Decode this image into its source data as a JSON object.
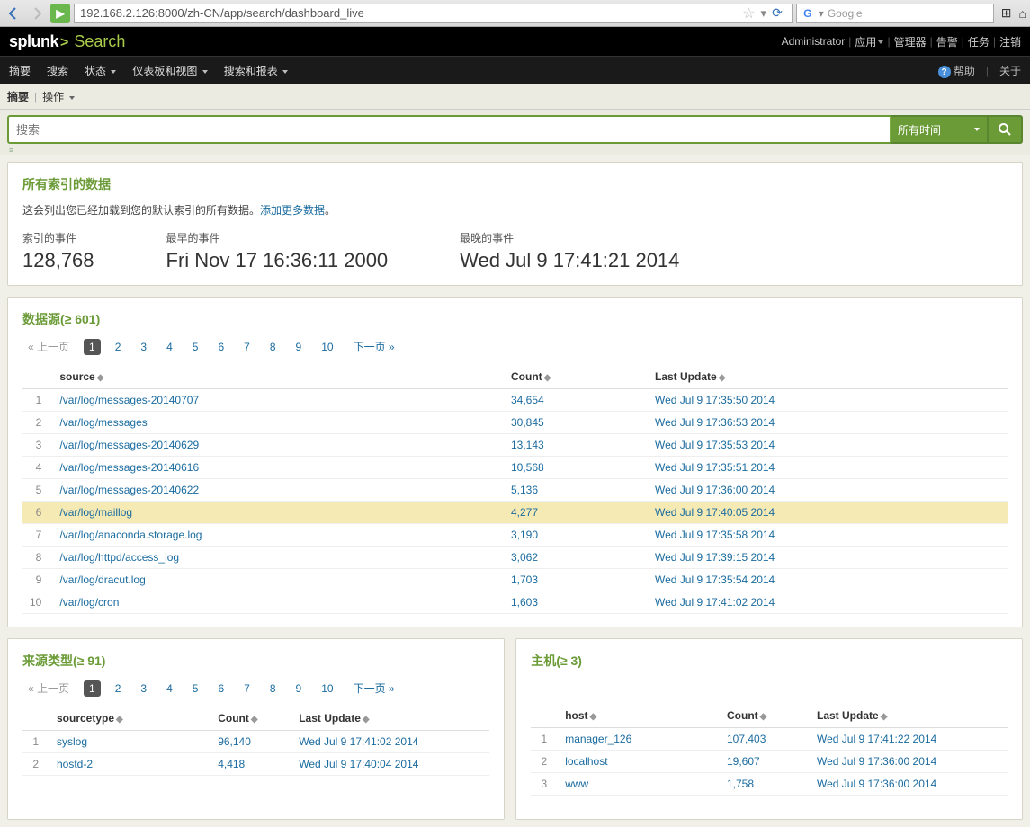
{
  "browser": {
    "url": "192.168.2.126:8000/zh-CN/app/search/dashboard_live",
    "search_placeholder": "Google"
  },
  "header": {
    "logo_primary": "splunk",
    "logo_secondary": "Search",
    "user": "Administrator",
    "top_links": {
      "app": "应用",
      "manager": "管理器",
      "alerts": "告警",
      "jobs": "任务",
      "logout": "注销"
    }
  },
  "nav": {
    "items": [
      "摘要",
      "搜索",
      "状态",
      "仪表板和视图",
      "搜索和报表"
    ],
    "help": "帮助",
    "about": "关于"
  },
  "subbar": {
    "summary": "摘要",
    "actions": "操作"
  },
  "search": {
    "placeholder": "搜索",
    "time": "所有时间"
  },
  "index_panel": {
    "title": "所有索引的数据",
    "desc": "这会列出您已经加载到您的默认索引的所有数据。",
    "add_more": "添加更多数据",
    "period": "。",
    "stats": [
      {
        "label": "索引的事件",
        "value": "128,768"
      },
      {
        "label": "最早的事件",
        "value": "Fri Nov 17 16:36:11 2000"
      },
      {
        "label": "最晚的事件",
        "value": "Wed Jul 9 17:41:21 2014"
      }
    ]
  },
  "sources_panel": {
    "title": "数据源(≥ 601)",
    "pagination": {
      "prev": "« 上一页",
      "pages": [
        "1",
        "2",
        "3",
        "4",
        "5",
        "6",
        "7",
        "8",
        "9",
        "10"
      ],
      "next": "下一页 »"
    },
    "columns": {
      "source": "source",
      "count": "Count",
      "last": "Last Update"
    },
    "rows": [
      {
        "n": "1",
        "source": "/var/log/messages-20140707",
        "count": "34,654",
        "last": "Wed Jul 9 17:35:50 2014"
      },
      {
        "n": "2",
        "source": "/var/log/messages",
        "count": "30,845",
        "last": "Wed Jul 9 17:36:53 2014"
      },
      {
        "n": "3",
        "source": "/var/log/messages-20140629",
        "count": "13,143",
        "last": "Wed Jul 9 17:35:53 2014"
      },
      {
        "n": "4",
        "source": "/var/log/messages-20140616",
        "count": "10,568",
        "last": "Wed Jul 9 17:35:51 2014"
      },
      {
        "n": "5",
        "source": "/var/log/messages-20140622",
        "count": "5,136",
        "last": "Wed Jul 9 17:36:00 2014"
      },
      {
        "n": "6",
        "source": "/var/log/maillog",
        "count": "4,277",
        "last": "Wed Jul 9 17:40:05 2014",
        "hl": true
      },
      {
        "n": "7",
        "source": "/var/log/anaconda.storage.log",
        "count": "3,190",
        "last": "Wed Jul 9 17:35:58 2014"
      },
      {
        "n": "8",
        "source": "/var/log/httpd/access_log",
        "count": "3,062",
        "last": "Wed Jul 9 17:39:15 2014"
      },
      {
        "n": "9",
        "source": "/var/log/dracut.log",
        "count": "1,703",
        "last": "Wed Jul 9 17:35:54 2014"
      },
      {
        "n": "10",
        "source": "/var/log/cron",
        "count": "1,603",
        "last": "Wed Jul 9 17:41:02 2014"
      }
    ]
  },
  "sourcetype_panel": {
    "title": "来源类型(≥ 91)",
    "pagination": {
      "prev": "« 上一页",
      "pages": [
        "1",
        "2",
        "3",
        "4",
        "5",
        "6",
        "7",
        "8",
        "9",
        "10"
      ],
      "next": "下一页 »"
    },
    "columns": {
      "source": "sourcetype",
      "count": "Count",
      "last": "Last Update"
    },
    "rows": [
      {
        "n": "1",
        "source": "syslog",
        "count": "96,140",
        "last": "Wed Jul 9 17:41:02 2014"
      },
      {
        "n": "2",
        "source": "hostd-2",
        "count": "4,418",
        "last": "Wed Jul 9 17:40:04 2014"
      }
    ]
  },
  "host_panel": {
    "title": "主机(≥ 3)",
    "columns": {
      "host": "host",
      "count": "Count",
      "last": "Last Update"
    },
    "rows": [
      {
        "n": "1",
        "host": "manager_126",
        "count": "107,403",
        "last": "Wed Jul 9 17:41:22 2014"
      },
      {
        "n": "2",
        "host": "localhost",
        "count": "19,607",
        "last": "Wed Jul 9 17:36:00 2014"
      },
      {
        "n": "3",
        "host": "www",
        "count": "1,758",
        "last": "Wed Jul 9 17:36:00 2014"
      }
    ]
  }
}
